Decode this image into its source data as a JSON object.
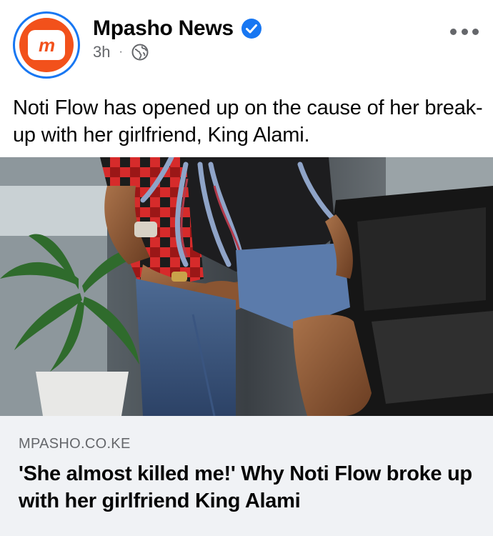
{
  "page": {
    "name": "Mpasho News",
    "verified": true,
    "time": "3h",
    "separator": "·",
    "audience_icon": "globe-icon",
    "avatar_logo_text": "m",
    "brand_color": "#f2511b",
    "verified_color": "#1877f2"
  },
  "post": {
    "text": "Noti Flow has opened up on the cause of her break-up with her girlfriend, King Alami."
  },
  "link_card": {
    "domain": "MPASHO.CO.KE",
    "title": "'She almost killed me!' Why Noti Flow broke up with her girlfriend King Alami"
  },
  "icons": {
    "more": "more-options-icon",
    "verified": "verified-badge-icon",
    "audience": "globe-icon"
  }
}
